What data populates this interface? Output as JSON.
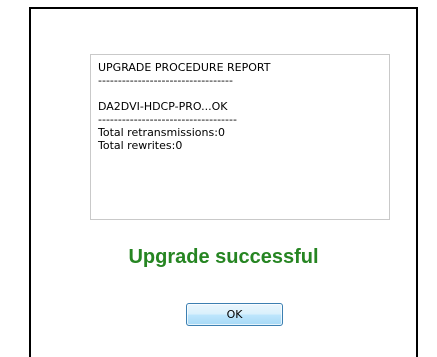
{
  "report": {
    "lines": [
      "UPGRADE PROCEDURE REPORT",
      "----------------------------------",
      "",
      "DA2DVI-HDCP-PRO...OK",
      "-----------------------------------",
      "Total retransmissions:0",
      "Total rewrites:0"
    ]
  },
  "status": {
    "text": "Upgrade successful",
    "color": "#268522"
  },
  "buttons": {
    "ok_label": "OK"
  }
}
